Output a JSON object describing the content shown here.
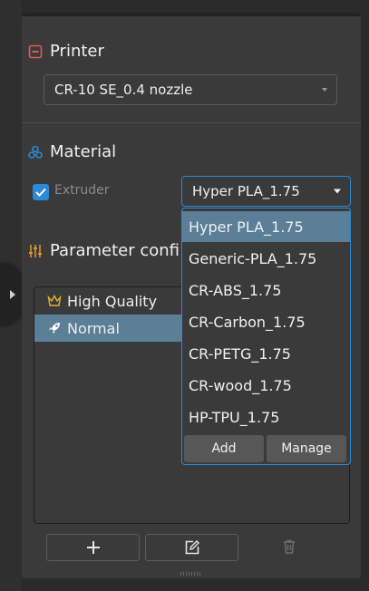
{
  "printer": {
    "title": "Printer",
    "selected": "CR-10 SE_0.4 nozzle"
  },
  "material": {
    "title": "Material",
    "extruder_label": "Extruder",
    "extruder_checked": true,
    "selected": "Hyper PLA_1.75",
    "options": [
      "Hyper PLA_1.75",
      "Generic-PLA_1.75",
      "CR-ABS_1.75",
      "CR-Carbon_1.75",
      "CR-PETG_1.75",
      "CR-wood_1.75",
      "HP-TPU_1.75"
    ],
    "add_label": "Add",
    "manage_label": "Manage"
  },
  "parameter": {
    "title": "Parameter confi",
    "profiles": [
      {
        "label": "High Quality",
        "icon": "crown-icon"
      },
      {
        "label": "Normal",
        "icon": "rocket-icon"
      }
    ],
    "selected_profile": "Normal"
  },
  "colors": {
    "accent": "#2b8ad8",
    "printer_icon": "#e05a5a",
    "parameter_icon": "#e0952a",
    "selected_item": "#5a7f96"
  }
}
